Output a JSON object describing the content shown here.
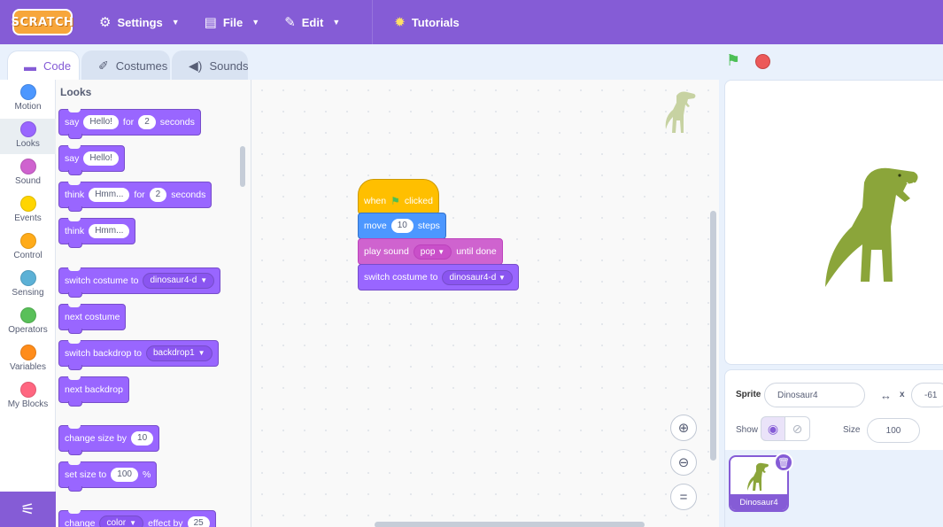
{
  "menubar": {
    "logo": "SCRATCH",
    "settings": "Settings",
    "file": "File",
    "edit": "Edit",
    "tutorials": "Tutorials"
  },
  "tabs": {
    "code": "Code",
    "costumes": "Costumes",
    "sounds": "Sounds"
  },
  "categories": [
    {
      "name": "Motion",
      "color": "#4c97ff"
    },
    {
      "name": "Looks",
      "color": "#9966ff"
    },
    {
      "name": "Sound",
      "color": "#cf63cf"
    },
    {
      "name": "Events",
      "color": "#ffd500"
    },
    {
      "name": "Control",
      "color": "#ffab19"
    },
    {
      "name": "Sensing",
      "color": "#5cb1d6"
    },
    {
      "name": "Operators",
      "color": "#59c059"
    },
    {
      "name": "Variables",
      "color": "#ff8c1a"
    },
    {
      "name": "My Blocks",
      "color": "#ff6680"
    }
  ],
  "palette": {
    "title": "Looks",
    "say_for": {
      "say": "say",
      "text": "Hello!",
      "for": "for",
      "secs": "2",
      "seconds": "seconds"
    },
    "say": {
      "say": "say",
      "text": "Hello!"
    },
    "think_for": {
      "think": "think",
      "text": "Hmm...",
      "for": "for",
      "secs": "2",
      "seconds": "seconds"
    },
    "think": {
      "think": "think",
      "text": "Hmm..."
    },
    "switch_costume": {
      "label": "switch costume to",
      "value": "dinosaur4-d"
    },
    "next_costume": "next costume",
    "switch_backdrop": {
      "label": "switch backdrop to",
      "value": "backdrop1"
    },
    "next_backdrop": "next backdrop",
    "change_size": {
      "label": "change size by",
      "value": "10"
    },
    "set_size": {
      "label": "set size to",
      "value": "100",
      "unit": "%"
    },
    "change_effect": {
      "label": "change",
      "effect": "color",
      "by": "effect by",
      "value": "25"
    }
  },
  "script": {
    "when_clicked": {
      "when": "when",
      "clicked": "clicked"
    },
    "move": {
      "label": "move",
      "value": "10",
      "steps": "steps"
    },
    "play_sound": {
      "label": "play sound",
      "value": "pop",
      "until": "until done"
    },
    "switch_costume": {
      "label": "switch costume to",
      "value": "dinosaur4-d"
    }
  },
  "sprite_info": {
    "sprite_label": "Sprite",
    "sprite_name": "Dinosaur4",
    "x_label": "x",
    "x_value": "-61",
    "show_label": "Show",
    "size_label": "Size",
    "size_value": "100"
  },
  "sprite_list": [
    {
      "name": "Dinosaur4"
    }
  ],
  "colors": {
    "accent": "#855cd6",
    "looks": "#9966ff",
    "motion": "#4c97ff",
    "events": "#ffbf00",
    "sound": "#cf63cf",
    "dino": "#8ba53a"
  }
}
